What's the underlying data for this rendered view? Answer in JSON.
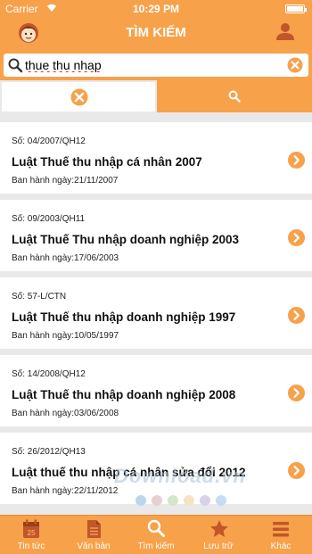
{
  "status": {
    "carrier": "Carrier",
    "time": "10:29 PM"
  },
  "header": {
    "title": "TÌM KIẾM"
  },
  "search": {
    "value": "thue thu nhap"
  },
  "results": [
    {
      "number": "Số: 04/2007/QH12",
      "title": "Luật Thuế thu nhập cá nhân 2007",
      "date": "Ban hành ngày:21/11/2007"
    },
    {
      "number": "Số: 09/2003/QH11",
      "title": "Luật Thuế Thu nhập doanh nghiệp 2003",
      "date": "Ban hành ngày:17/06/2003"
    },
    {
      "number": "Số: 57-L/CTN",
      "title": "Luật Thuế thu nhập doanh nghiệp 1997",
      "date": "Ban hành ngày:10/05/1997"
    },
    {
      "number": "Số: 14/2008/QH12",
      "title": "Luật Thuế thu nhập doanh nghiệp 2008",
      "date": "Ban hành ngày:03/06/2008"
    },
    {
      "number": "Số: 26/2012/QH13",
      "title": "Luật thuế thu nhập cá nhân sửa đổi 2012",
      "date": "Ban hành ngày:22/11/2012"
    }
  ],
  "watermark": {
    "text": "Download.vn",
    "dot_colors": [
      "#bcd6ea",
      "#e8d0d0",
      "#d6e6c8",
      "#f3e4c4",
      "#d8d2ea",
      "#c8dcf0"
    ]
  },
  "tabs": [
    {
      "label": "Tin tức",
      "icon": "calendar-icon"
    },
    {
      "label": "Văn bản",
      "icon": "document-icon"
    },
    {
      "label": "Tìm kiếm",
      "icon": "search-icon"
    },
    {
      "label": "Lưu trữ",
      "icon": "star-icon"
    },
    {
      "label": "Khác",
      "icon": "menu-icon"
    }
  ],
  "colors": {
    "accent": "#f7a14a",
    "background": "#e9e9ea",
    "arrow": "#f7a14a"
  }
}
